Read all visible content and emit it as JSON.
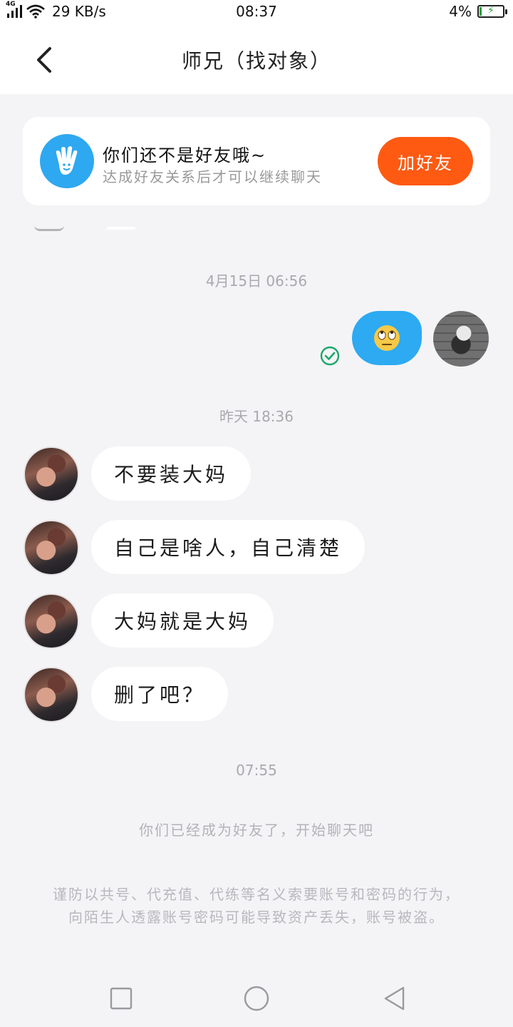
{
  "status_bar": {
    "network": "4G",
    "speed": "29 KB/s",
    "time": "08:37",
    "battery": "4%"
  },
  "header": {
    "title": "师兄（找对象）"
  },
  "friend_banner": {
    "title": "你们还不是好友哦~",
    "subtitle": "达成好友关系后才可以继续聊天",
    "button_label": "加好友",
    "button_color": "#ff5a12"
  },
  "messages": {
    "time_1": "4月15日 06:56",
    "time_2": "昨天 18:36",
    "incoming": [
      "不要装大妈",
      "自己是啥人，自己清楚",
      "大妈就是大妈",
      "删了吧？"
    ],
    "time_3": "07:55"
  },
  "system": {
    "friend_notice": "你们已经成为好友了，开始聊天吧",
    "warning": "谨防以共号、代充值、代练等名义索要账号和密码的行为，向陌生人透露账号密码可能导致资产丢失，账号被盗。"
  },
  "colors": {
    "self_bubble": "#2daaf2",
    "read_check": "#1aa86a"
  }
}
